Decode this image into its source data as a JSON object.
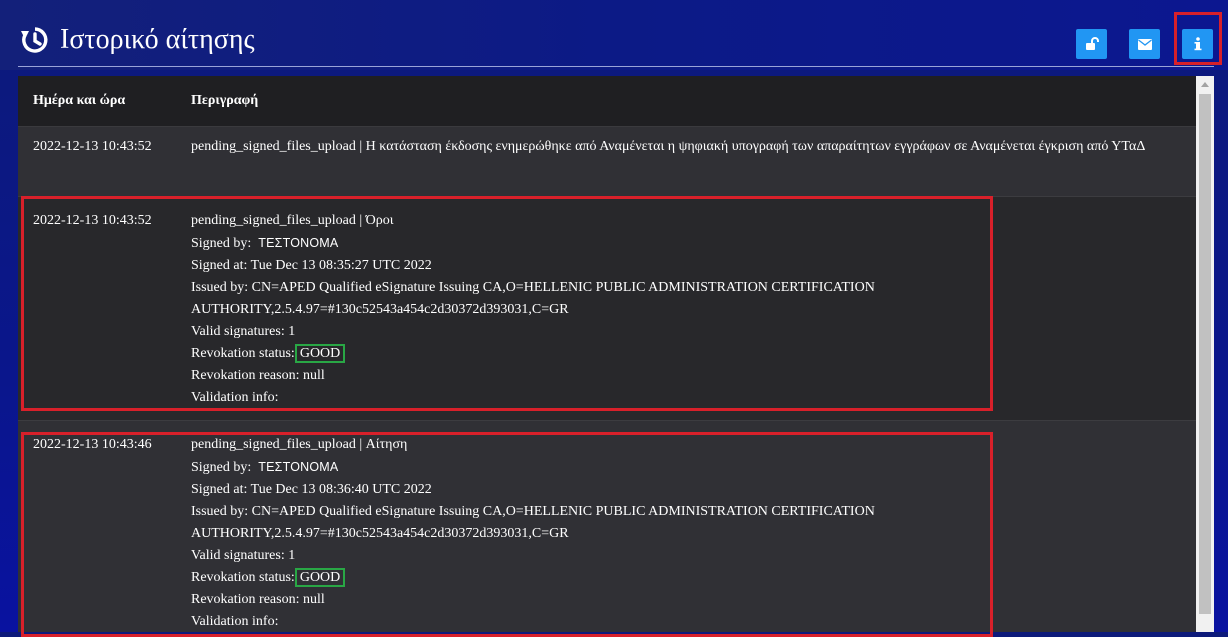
{
  "header": {
    "title": "Ιστορικό αίτησης",
    "buttons": {
      "unlock": "unlock-icon",
      "mail": "envelope-icon",
      "info": "info-icon"
    }
  },
  "table": {
    "headers": {
      "date": "Ημέρα και ώρα",
      "description": "Περιγραφή"
    },
    "rows": [
      {
        "date": "2022-12-13 10:43:52",
        "text": "pending_signed_files_upload | Η κατάσταση έκδοσης ενημερώθηκε από Αναμένεται η ψηφιακή υπογραφή των απαραίτητων εγγράφων σε Αναμένεται έγκριση από ΥΤαΔ"
      },
      {
        "date": "2022-12-13 10:43:52",
        "title": "pending_signed_files_upload | Όροι",
        "signed_by_label": "Signed by:",
        "signed_by": "ΤΕΣΤΟΝΟΜΑ",
        "signed_at": "Signed at: Tue Dec 13 08:35:27 UTC 2022",
        "issued_by_1": "Issued by: CN=APED Qualified eSignature Issuing CA,O=HELLENIC PUBLIC ADMINISTRATION CERTIFICATION",
        "issued_by_2": "AUTHORITY,2.5.4.97=#130c52543a454c2d30372d393031,C=GR",
        "valid_signatures": "Valid signatures: 1",
        "revocation_label": "Revokation status:",
        "revocation_status": "GOOD",
        "revocation_reason": "Revokation reason: null",
        "validation_info": "Validation info:"
      },
      {
        "date": "2022-12-13 10:43:46",
        "title": "pending_signed_files_upload | Αίτηση",
        "signed_by_label": "Signed by:",
        "signed_by": "ΤΕΣΤΟΝΟΜΑ",
        "signed_at": "Signed at: Tue Dec 13 08:36:40 UTC 2022",
        "issued_by_1": "Issued by: CN=APED Qualified eSignature Issuing CA,O=HELLENIC PUBLIC ADMINISTRATION CERTIFICATION",
        "issued_by_2": "AUTHORITY,2.5.4.97=#130c52543a454c2d30372d393031,C=GR",
        "valid_signatures": "Valid signatures: 1",
        "revocation_label": "Revokation status:",
        "revocation_status": "GOOD",
        "revocation_reason": "Revokation reason: null",
        "validation_info": "Validation info:"
      }
    ]
  },
  "colors": {
    "button": "#2196f3",
    "highlight_red": "#d8202a",
    "highlight_green": "#29a745",
    "header_bg": "#0c1a86"
  }
}
